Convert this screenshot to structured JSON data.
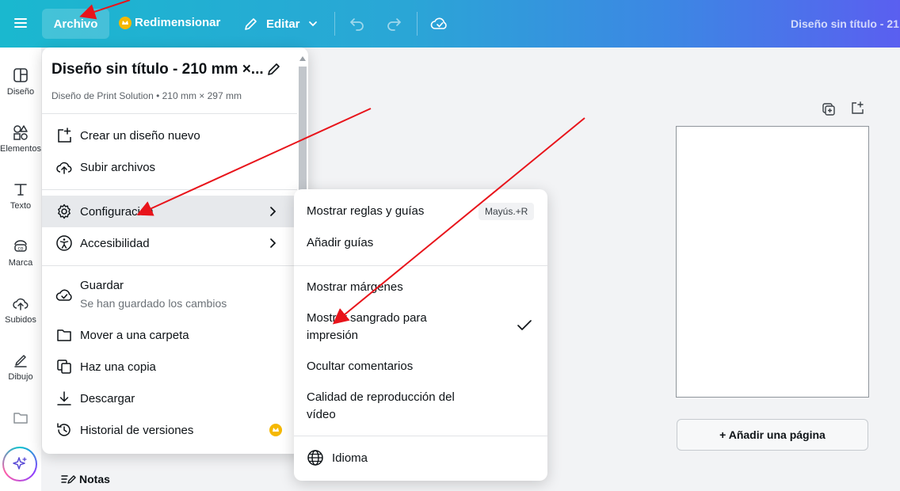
{
  "topbar": {
    "menu_icon": "hamburger-icon",
    "file_label": "Archivo",
    "resize_label": "Redimensionar",
    "edit_label": "Editar",
    "doc_title": "Diseño sin título - 21"
  },
  "sidebar": {
    "items": [
      {
        "label": "Diseño",
        "icon": "layout-icon"
      },
      {
        "label": "Elementos",
        "icon": "shapes-icon"
      },
      {
        "label": "Texto",
        "icon": "text-icon"
      },
      {
        "label": "Marca",
        "icon": "brand-icon"
      },
      {
        "label": "Subidos",
        "icon": "cloud-upload-icon"
      },
      {
        "label": "Dibujo",
        "icon": "pen-icon"
      }
    ]
  },
  "file_menu": {
    "title": "Diseño sin título - 210 mm ×...",
    "subtitle": "Diseño de Print Solution • 210 mm × 297 mm",
    "items": [
      {
        "label": "Crear un diseño nuevo"
      },
      {
        "label": "Subir archivos"
      },
      {
        "label": "Configuración"
      },
      {
        "label": "Accesibilidad"
      },
      {
        "label": "Guardar",
        "sublabel": "Se han guardado los cambios"
      },
      {
        "label": "Mover a una carpeta"
      },
      {
        "label": "Haz una copia"
      },
      {
        "label": "Descargar"
      },
      {
        "label": "Historial de versiones"
      }
    ]
  },
  "settings_submenu": {
    "items": [
      {
        "label": "Mostrar reglas y guías",
        "shortcut": "Mayús.+R"
      },
      {
        "label": "Añadir guías"
      },
      {
        "label": "Mostrar márgenes"
      },
      {
        "label": "Mostrar sangrado para impresión",
        "checked": true
      },
      {
        "label": "Ocultar comentarios"
      },
      {
        "label": "Calidad de reproducción del vídeo"
      },
      {
        "label": "Idioma"
      }
    ]
  },
  "canvas": {
    "add_page_label": "+ Añadir una página"
  },
  "footer": {
    "notes_label": "Notas"
  },
  "colors": {
    "accent": "#8b3dff",
    "crown": "#f5b800",
    "annotation_arrow": "#e8141b"
  }
}
